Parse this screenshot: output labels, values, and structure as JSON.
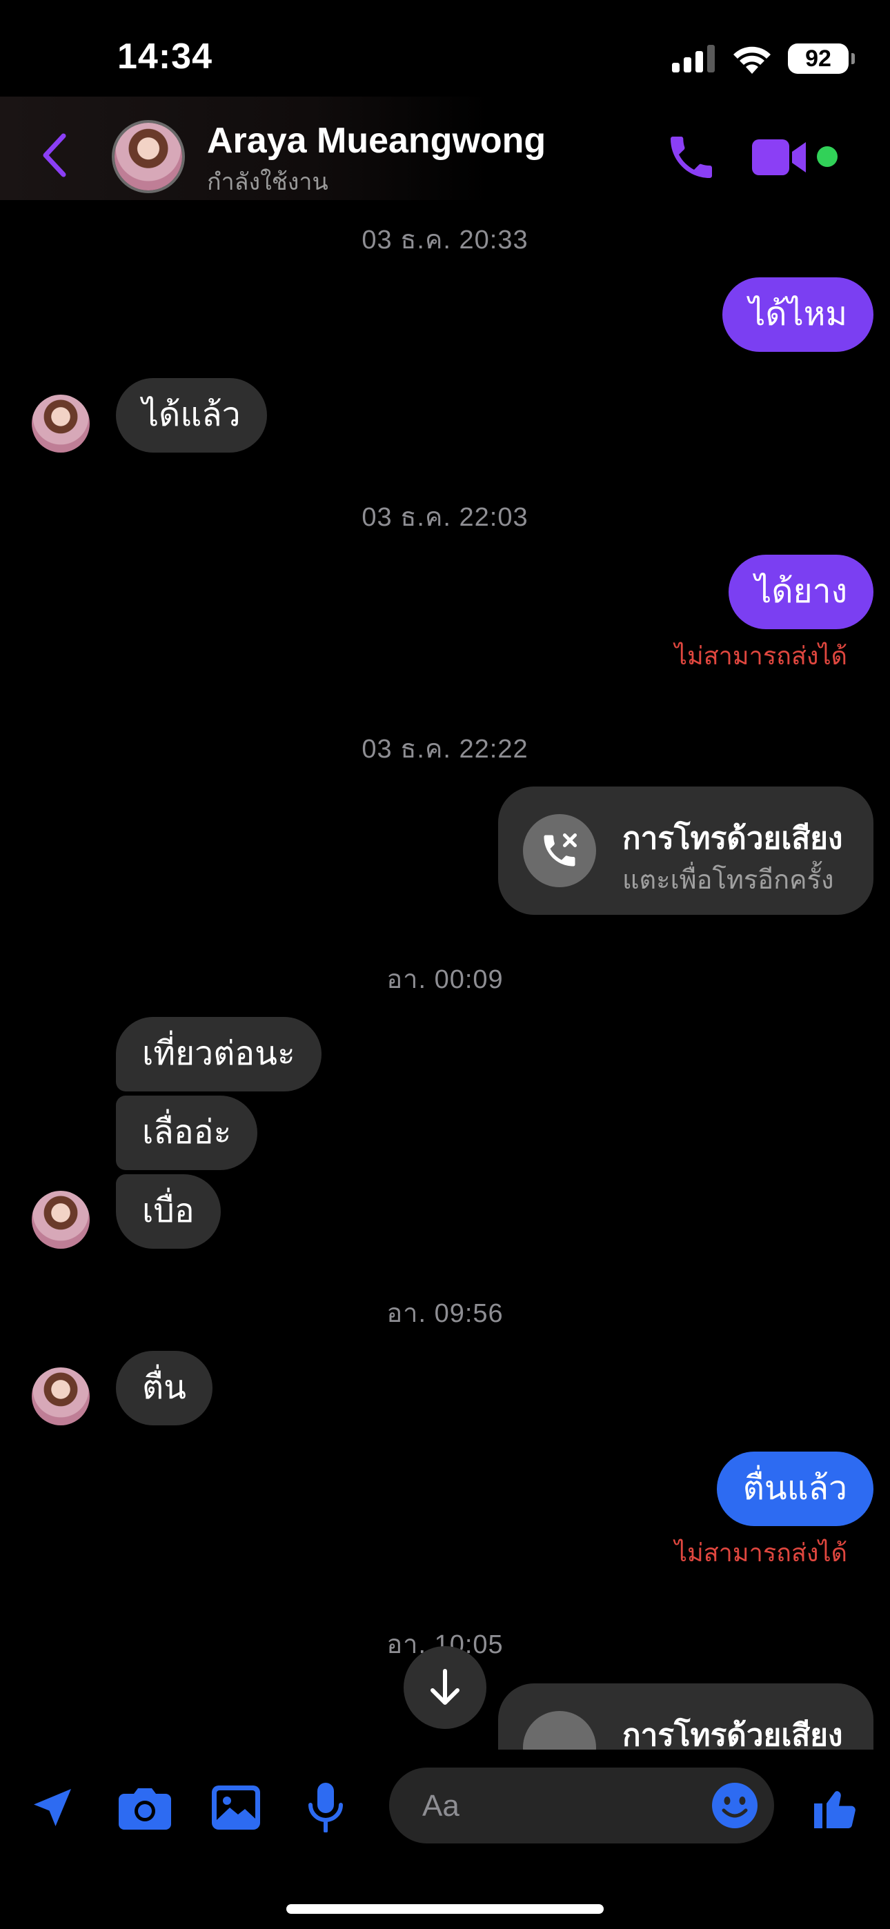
{
  "status_bar": {
    "time": "14:34",
    "battery": "92"
  },
  "header": {
    "name": "Araya Mueangwong",
    "status": "กำลังใช้งาน"
  },
  "messages": {
    "ts1": "03 ธ.ค. 20:33",
    "out1": "ได้ไหม",
    "in1": "ได้แล้ว",
    "ts2": "03 ธ.ค. 22:03",
    "out2": "ได้ยาง",
    "fail1": "ไม่สามารถส่งได้",
    "ts3": "03 ธ.ค. 22:22",
    "call1_title": "การโทรด้วยเสียง",
    "call1_sub": "แตะเพื่อโทรอีกครั้ง",
    "ts4": "อา. 00:09",
    "in2": "เที่ยวต่อนะ",
    "in3": "เลื่ออ่ะ",
    "in4": "เบื่อ",
    "ts5": "อา. 09:56",
    "in5": "ตื่น",
    "out3": "ตื่นแล้ว",
    "fail2": "ไม่สามารถส่งได้",
    "ts6": "อา. 10:05",
    "call2_title": "การโทรด้วยเสียง"
  },
  "composer": {
    "placeholder": "Aa"
  },
  "colors": {
    "accent_purple": "#7b3ff2",
    "accent_blue": "#2d6bf2",
    "error": "#e0473f",
    "active": "#31d158"
  },
  "icons": [
    "back-icon",
    "phone-icon",
    "video-icon",
    "missed-call-icon",
    "location-icon",
    "camera-icon",
    "image-icon",
    "mic-icon",
    "emoji-icon",
    "thumbs-up-icon",
    "arrow-down-icon"
  ]
}
